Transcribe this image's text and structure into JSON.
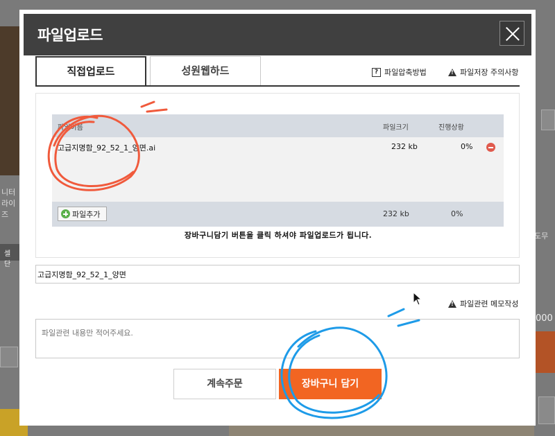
{
  "modal": {
    "title": "파일업로드",
    "tabs": [
      {
        "label": "직접업로드",
        "active": true
      },
      {
        "label": "성원웹하드",
        "active": false
      }
    ],
    "links": {
      "compress_help": "파일압축방법",
      "save_caution": "파일저장 주의사항"
    },
    "table": {
      "headers": {
        "name": "파일이름",
        "size": "파일크기",
        "progress": "진행상황"
      },
      "rows": [
        {
          "name": "고급지명함_92_52_1_양면.ai",
          "size": "232 kb",
          "progress": "0%"
        }
      ],
      "footer": {
        "add_label": "파일추가",
        "total_size": "232 kb",
        "total_progress": "0%"
      }
    },
    "notice": "장바구니담기 버튼을 클릭 하셔야 파일업로드가 됩니다.",
    "filename_value": "고급지명함_92_52_1_양면",
    "memo_link": "파일관련 메모작성",
    "memo_placeholder": "파일관련 내용만 적어주세요.",
    "buttons": {
      "continue": "계속주문",
      "add_to_cart": "장바구니 담기"
    }
  },
  "background": {
    "left_text": "니터\n라이즈",
    "left_button": "셀 단",
    "right_text": "도무",
    "right_number": "000"
  },
  "colors": {
    "header_bg": "#404040",
    "accent_orange": "#f26522",
    "table_header_bg": "#d6dbe2",
    "annotation_red": "#f05a3c",
    "annotation_blue": "#1e9be8"
  }
}
